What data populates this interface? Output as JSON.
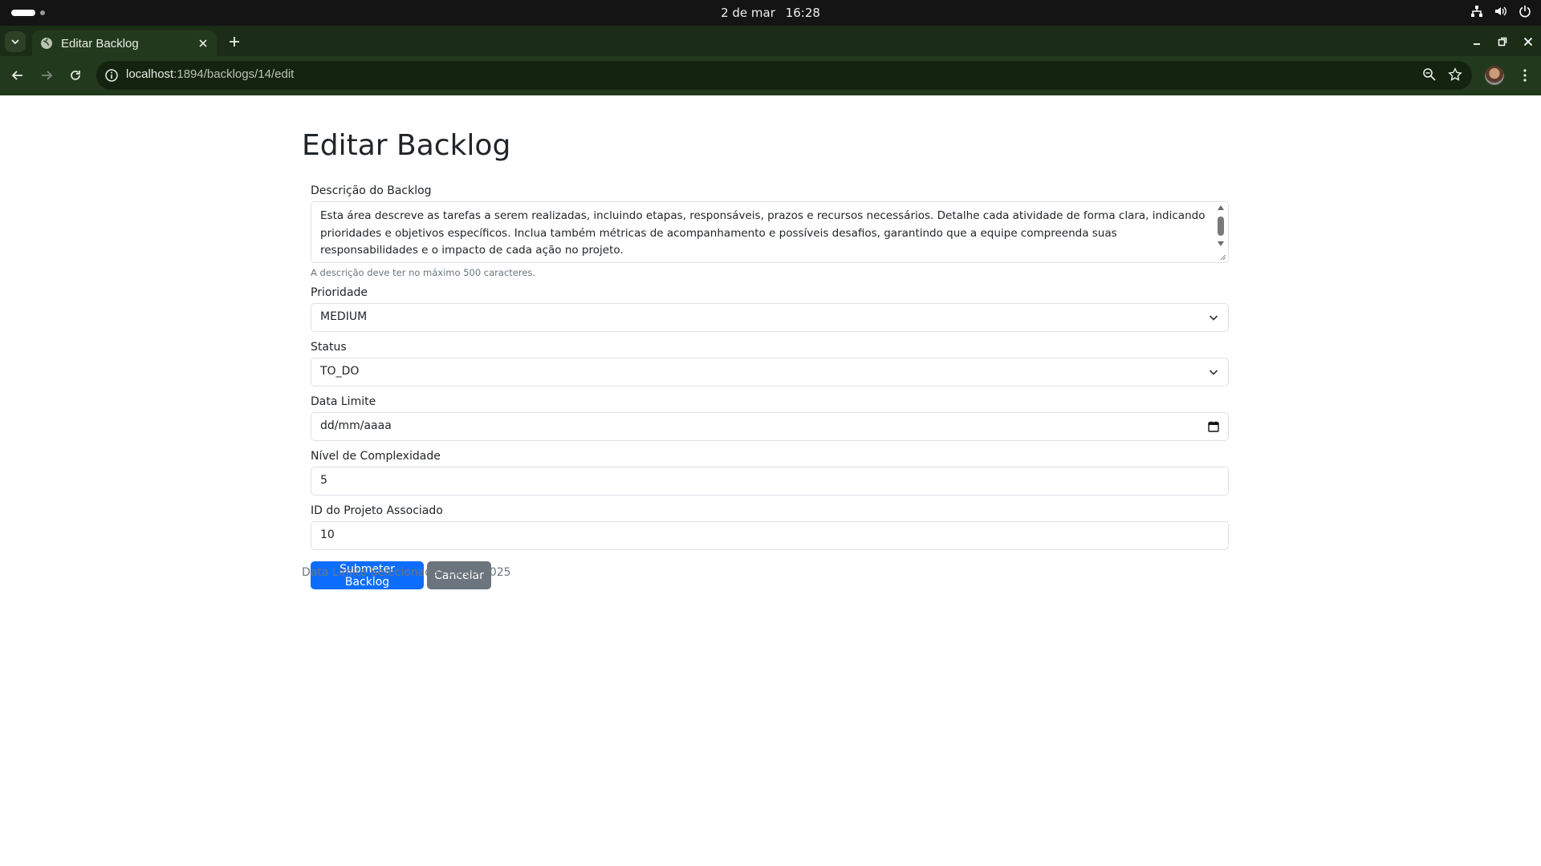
{
  "os": {
    "date": "2 de mar",
    "time": "16:28"
  },
  "browser": {
    "tab_title": "Editar Backlog",
    "url_host": "localhost",
    "url_rest": ":1894/backlogs/14/edit"
  },
  "page": {
    "title": "Editar Backlog",
    "description": {
      "label": "Descrição do Backlog",
      "value": "Esta área descreve as tarefas a serem realizadas, incluindo etapas, responsáveis, prazos e recursos necessários. Detalhe cada atividade de forma clara, indicando prioridades e objetivos específicos. Inclua também métricas de acompanhamento e possíveis desafios, garantindo que a equipe compreenda suas responsabilidades e o impacto de cada ação no projeto.",
      "help": "A descrição deve ter no máximo 500 caracteres."
    },
    "priority": {
      "label": "Prioridade",
      "value": "MEDIUM"
    },
    "status": {
      "label": "Status",
      "value": "TO_DO"
    },
    "due_date": {
      "label": "Data Limite",
      "value": "dd/mm/aaaa"
    },
    "complexity": {
      "label": "Nível de Complexidade",
      "value": "5"
    },
    "project_id": {
      "label": "ID do Projeto Associado",
      "value": "10"
    },
    "submit_label": "Submeter Backlog",
    "cancel_label": "Cancelar",
    "selected_date_text": "Data Limite Selecionada: 10/09/2025"
  },
  "colors": {
    "primary": "#0d6efd",
    "secondary": "#6c757d",
    "browser_frame": "#23391d"
  },
  "icons": [
    "network-icon",
    "volume-icon",
    "power-icon",
    "globe-icon",
    "close-icon",
    "plus-icon",
    "minimize-icon",
    "restore-icon",
    "back-icon",
    "forward-icon",
    "reload-icon",
    "info-icon",
    "zoom-icon",
    "star-icon",
    "kebab-menu-icon",
    "chevron-down-icon",
    "calendar-icon"
  ]
}
